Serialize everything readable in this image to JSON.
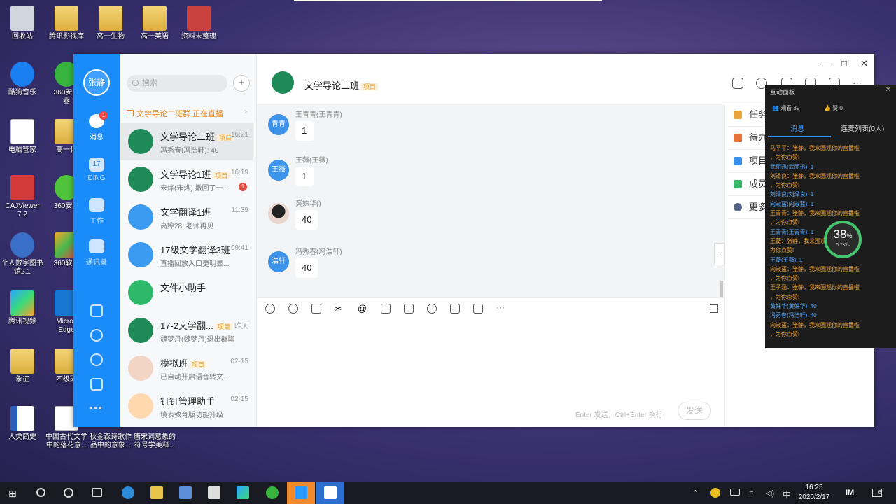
{
  "desktop": {
    "icons": [
      {
        "label": "回收站"
      },
      {
        "label": "腾讯影视库"
      },
      {
        "label": "高一生物"
      },
      {
        "label": "高一英语"
      },
      {
        "label": "资料未整理"
      },
      {
        "label": "酷狗音乐"
      },
      {
        "label": "360安全\n器"
      },
      {
        "label": "电脑管家"
      },
      {
        "label": "高一化"
      },
      {
        "label": "CAJViewer\n7.2"
      },
      {
        "label": "360安全"
      },
      {
        "label": "个人数字图书\n馆2.1"
      },
      {
        "label": "360软件"
      },
      {
        "label": "腾讯视频"
      },
      {
        "label": "Micros\nEdge"
      },
      {
        "label": "象征"
      },
      {
        "label": "四级副"
      },
      {
        "label": "人类简史"
      },
      {
        "label": "中国古代文学\n中的落花意..."
      },
      {
        "label": "秋金森诗歌作\n品中的意象..."
      },
      {
        "label": "唐宋词意象的\n符号学美释..."
      }
    ]
  },
  "app": {
    "user_name": "张静",
    "rail": {
      "messages_label": "消息",
      "messages_badge": "1",
      "ding_label": "DING",
      "ding_day": "17",
      "work_label": "工作",
      "contacts_label": "通讯录"
    },
    "search_placeholder": "搜索",
    "live_banner": "文学导论二班群 正在直播",
    "conversations": [
      {
        "name": "文学导论二班",
        "tag": "项目",
        "time": "16:21",
        "msg": "冯秀春(冯浩轩): 40",
        "badge": ""
      },
      {
        "name": "文学导论1班",
        "tag": "项目",
        "time": "16:19",
        "msg": "宋烨(宋烨) 撤回了一...",
        "badge": "1"
      },
      {
        "name": "文学翻译1班",
        "tag": "",
        "time": "11:39",
        "msg": "高婷28: 老师再见",
        "badge": ""
      },
      {
        "name": "17级文学翻译3班",
        "tag": "",
        "time": "09:41",
        "msg": "直播回放入口更明显...",
        "badge": ""
      },
      {
        "name": "文件小助手",
        "tag": "",
        "time": "",
        "msg": "",
        "badge": ""
      },
      {
        "name": "17-2文学翻...",
        "tag": "项目",
        "time": "昨天",
        "msg": "魏梦丹(魏梦丹)退出群聊",
        "badge": ""
      },
      {
        "name": "模拟班",
        "tag": "项目",
        "time": "02-15",
        "msg": "已自动开启语音转文...",
        "badge": ""
      },
      {
        "name": "钉钉管理助手",
        "tag": "",
        "time": "02-15",
        "msg": "填表教育版功能升级",
        "badge": ""
      }
    ],
    "chat": {
      "title": "文学导论二班",
      "tag": "项目",
      "messages": [
        {
          "avatar": "青青",
          "sender": "王青青(王青青)",
          "text": "1"
        },
        {
          "avatar": "王薇",
          "sender": "王薇(王薇)",
          "text": "1"
        },
        {
          "avatar": "",
          "sender": "黄姝华()",
          "text": "40"
        },
        {
          "avatar": "浩轩",
          "sender": "冯秀春(冯浩轩)",
          "text": "40"
        }
      ],
      "input_hint": "Enter 发送，Ctrl+Enter 换行",
      "send_label": "发送"
    },
    "side": [
      {
        "label": "任务",
        "color": "#e8a53a"
      },
      {
        "label": "待办",
        "color": "#e8733a"
      },
      {
        "label": "项目",
        "color": "#3a8fe8"
      },
      {
        "label": "成员",
        "color": "#3ab86a"
      },
      {
        "label": "更多",
        "color": "#5a6a8a"
      }
    ]
  },
  "panel": {
    "title": "互动面板",
    "viewers": "观看 39",
    "likes": "赞 0",
    "tab_messages": "消息",
    "tab_mic": "连麦列表(0人)",
    "log": [
      {
        "t": "马平平：张静，我来围观你的直播啦",
        "c": "or"
      },
      {
        "t": "，为你点赞!",
        "c": "or"
      },
      {
        "t": "武丽迅(武丽迅): 1",
        "c": "bl"
      },
      {
        "t": "刘泽良：张静，我来围观你的直播啦",
        "c": "or"
      },
      {
        "t": "，为你点赞!",
        "c": "or"
      },
      {
        "t": "刘泽良(刘泽良): 1",
        "c": "bl"
      },
      {
        "t": "向淑蓝(向淑蓝): 1",
        "c": "bl"
      },
      {
        "t": "王青青：张静，我来围观你的直播啦",
        "c": "or"
      },
      {
        "t": "，为你点赞!",
        "c": "or"
      },
      {
        "t": "王青青(王青青): 1",
        "c": "bl"
      },
      {
        "t": "王薇：张静，我来围观你的直播",
        "c": "or"
      },
      {
        "t": "为你点赞!",
        "c": "or"
      },
      {
        "t": "王薇(王薇): 1",
        "c": "bl"
      },
      {
        "t": "向淑蓝：张静，我来围观你的直播啦",
        "c": "or"
      },
      {
        "t": "，为你点赞!",
        "c": "or"
      },
      {
        "t": "王子涵：张静，我来围观你的直播啦",
        "c": "or"
      },
      {
        "t": "，为你点赞!",
        "c": "or"
      },
      {
        "t": "黄姝华(黄姝华): 40",
        "c": "bl"
      },
      {
        "t": "冯秀春(冯浩轩): 40",
        "c": "bl"
      },
      {
        "t": "向淑蓝：张静，我来围观你的直播啦",
        "c": "or"
      },
      {
        "t": "，为你点赞!",
        "c": "or"
      }
    ]
  },
  "gauge": {
    "percent": "38",
    "unit": "%",
    "speed": "0.7K/s"
  },
  "taskbar": {
    "time": "16:25",
    "date": "2020/2/17",
    "ime": "中",
    "notifications": "6"
  }
}
